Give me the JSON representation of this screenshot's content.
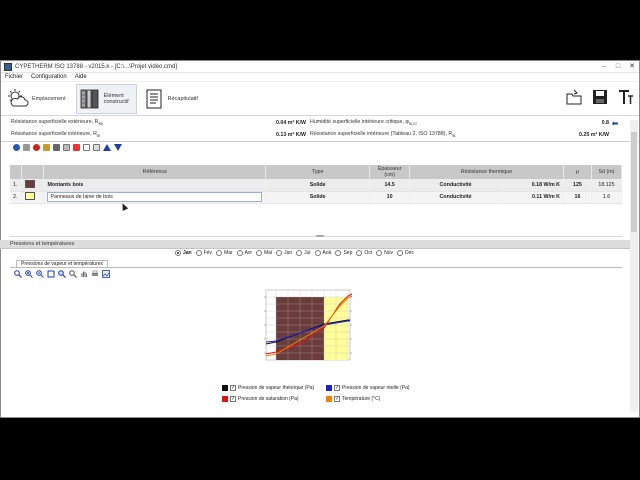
{
  "window": {
    "title": "CYPETHERM ISO 13788 - v2015.k - [C:\\...\\Projet vidéo.cmd]"
  },
  "menu": [
    "Fichier",
    "Configuration",
    "Aide"
  ],
  "toolbar": {
    "items": [
      {
        "label": "Emplacement",
        "icon": "weather-icon"
      },
      {
        "label": "Élément constructif",
        "icon": "wall-layers-icon"
      },
      {
        "label": "Récapitulatif",
        "icon": "document-list-icon"
      }
    ],
    "right_icons": [
      "open-folder-icon",
      "save-icon",
      "text-icon"
    ]
  },
  "resistances": {
    "exterior_label": "Résistance superficielle extérieure, R",
    "exterior_sub": "se",
    "exterior_value": "0.04 m² K/W",
    "humidity_label": "Humidité superficielle intérieure critique, φ",
    "humidity_sub": "si,cr",
    "humidity_value": "0.8",
    "interior_label": "Résistance superficielle intérieure, R",
    "interior_sub": "si",
    "interior_value": "0.13 m² K/W",
    "interior2_label": "Résistance superficielle intérieure (Tableau 2, ISO 13788), R",
    "interior2_sub": "si",
    "interior2_value": "0.25 m² K/W"
  },
  "layers": {
    "headers": [
      "Référence",
      "Type",
      "Épaisseur (cm)",
      "Résistance thermique",
      "μ",
      "Sd (m)"
    ],
    "rows": [
      {
        "index": "1.",
        "color": "#6b3c3c",
        "reference": "Montants bois",
        "type": "Solide",
        "thickness": "14.5",
        "resistance_type": "Conductivité",
        "resistance_value": "0.18 W/m K",
        "mu": "125",
        "sd": "18.125"
      },
      {
        "index": "2.",
        "color": "#ffff99",
        "reference": "Panneaux de laine de bois",
        "type": "Solide",
        "thickness": "10",
        "resistance_type": "Conductivité",
        "resistance_value": "0.11 W/m K",
        "mu": "16",
        "sd": "1.6"
      }
    ]
  },
  "section_title": "Pressions et températures",
  "months": [
    "Jan",
    "Fév",
    "Mar",
    "Avr",
    "Mai",
    "Jun",
    "Jul",
    "Aoû",
    "Sep",
    "Oct",
    "Nov",
    "Déc"
  ],
  "selected_month": "Jan",
  "subtab": "Pressions de vapeur et températures",
  "legend": [
    {
      "label": "Pression de vapeur théorique (Pa)",
      "color": "#111111"
    },
    {
      "label": "Pression de vapeur réelle (Pa)",
      "color": "#1f1fd0"
    },
    {
      "label": "Pression de saturation (Pa)",
      "color": "#e01010"
    },
    {
      "label": "Température (°C)",
      "color": "#f08000"
    }
  ],
  "colors": {
    "accent": "#1b3fa6",
    "header_gray": "#c8c8c8"
  }
}
